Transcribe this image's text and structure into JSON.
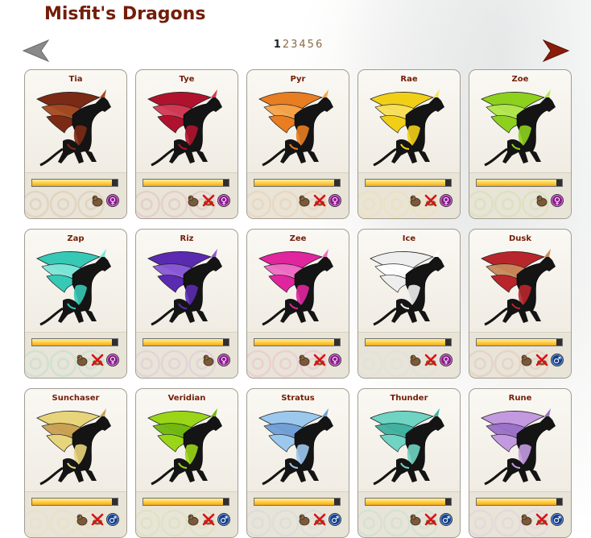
{
  "page_title": "Misfit's Dragons",
  "pagination": {
    "current": "1",
    "pages": [
      "1",
      "2",
      "3",
      "4",
      "5",
      "6"
    ]
  },
  "icons": {
    "prev": "left-arrow-icon",
    "next": "right-arrow-icon",
    "pet": "familiar-icon",
    "nest": "no-nest-icon",
    "female": "female-icon",
    "male": "male-icon"
  },
  "colors": {
    "title": "#731d08",
    "prev_arrow": "#8a8a8a",
    "next_arrow": "#8a1c0c",
    "female": "#8a1c8e",
    "male": "#14408e",
    "bar_fill": "#ffc93a"
  },
  "dragons": [
    {
      "name": "Tia",
      "color": "#7a2a15",
      "accent": "#a54a22",
      "level": 0.93,
      "familiar": true,
      "nest": false,
      "gender": "female",
      "gender_symbol": "♀",
      "swirl": "#c9a06a"
    },
    {
      "name": "Tye",
      "color": "#b0122e",
      "accent": "#d23b55",
      "level": 0.93,
      "familiar": true,
      "nest": true,
      "gender": "female",
      "gender_symbol": "♀",
      "swirl": "#e08a99"
    },
    {
      "name": "Pyr",
      "color": "#e87d21",
      "accent": "#f6a54a",
      "level": 0.93,
      "familiar": true,
      "nest": true,
      "gender": "female",
      "gender_symbol": "♀",
      "swirl": "#f0ad6b"
    },
    {
      "name": "Rae",
      "color": "#f2cf17",
      "accent": "#f8e15a",
      "level": 0.93,
      "familiar": true,
      "nest": true,
      "gender": "female",
      "gender_symbol": "♀",
      "swirl": "#f3da6b"
    },
    {
      "name": "Zoe",
      "color": "#8dd11e",
      "accent": "#b2e84f",
      "level": 0.93,
      "familiar": true,
      "nest": false,
      "gender": "female",
      "gender_symbol": "♀",
      "swirl": "#a8d86f"
    },
    {
      "name": "Zap",
      "color": "#35c9b6",
      "accent": "#7ee6d8",
      "level": 0.93,
      "familiar": true,
      "nest": true,
      "gender": "female",
      "gender_symbol": "♀",
      "swirl": "#6fd6c8"
    },
    {
      "name": "Riz",
      "color": "#5a2ab0",
      "accent": "#8a5ad8",
      "level": 0.93,
      "familiar": true,
      "nest": false,
      "gender": "female",
      "gender_symbol": "♀",
      "swirl": "#c79be0"
    },
    {
      "name": "Zee",
      "color": "#e0259e",
      "accent": "#f06ec4",
      "level": 0.93,
      "familiar": true,
      "nest": true,
      "gender": "female",
      "gender_symbol": "♀",
      "swirl": "#ef86c2"
    },
    {
      "name": "Ice",
      "color": "#eeeeee",
      "accent": "#ffffff",
      "level": 0.93,
      "familiar": true,
      "nest": true,
      "gender": "female",
      "gender_symbol": "♀",
      "swirl": "#c7d6e8"
    },
    {
      "name": "Dusk",
      "color": "#b8262b",
      "accent": "#c98a5a",
      "level": 0.93,
      "familiar": true,
      "nest": true,
      "gender": "male",
      "gender_symbol": "♂",
      "swirl": "#d59a8a"
    },
    {
      "name": "Sunchaser",
      "color": "#e8d47a",
      "accent": "#c9a052",
      "level": 0.93,
      "familiar": true,
      "nest": true,
      "gender": "male",
      "gender_symbol": "♂",
      "swirl": "#e9d59a"
    },
    {
      "name": "Veridian",
      "color": "#9ad617",
      "accent": "#6fb80e",
      "level": 0.93,
      "familiar": true,
      "nest": true,
      "gender": "male",
      "gender_symbol": "♂",
      "swirl": "#b8e07a"
    },
    {
      "name": "Stratus",
      "color": "#9cc8ee",
      "accent": "#6f9ed6",
      "level": 0.93,
      "familiar": true,
      "nest": true,
      "gender": "male",
      "gender_symbol": "♂",
      "swirl": "#a9cdee"
    },
    {
      "name": "Thunder",
      "color": "#6fd4c2",
      "accent": "#3fb0a0",
      "level": 0.93,
      "familiar": true,
      "nest": true,
      "gender": "male",
      "gender_symbol": "♂",
      "swirl": "#8adccd"
    },
    {
      "name": "Rune",
      "color": "#c39ae0",
      "accent": "#9a6fc8",
      "level": 0.93,
      "familiar": true,
      "nest": true,
      "gender": "male",
      "gender_symbol": "♂",
      "swirl": "#d2b2ea"
    }
  ]
}
